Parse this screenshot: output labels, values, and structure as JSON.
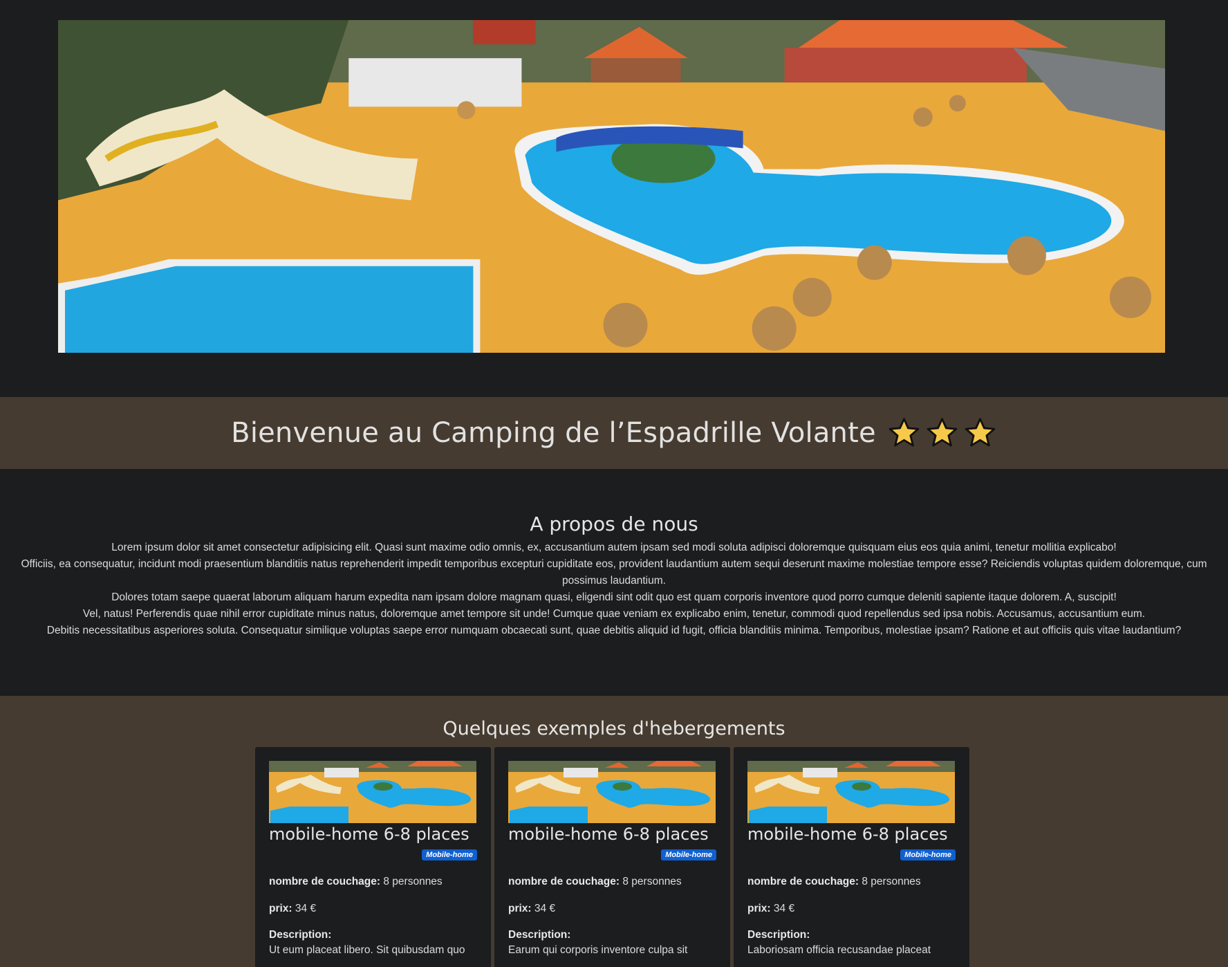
{
  "hero": {
    "alt": "Piscine et toboggans du camping"
  },
  "welcome": {
    "title": "Bienvenue au Camping de l’Espadrille Volante",
    "stars": 3,
    "star_color": "#f7c94a"
  },
  "about": {
    "title": "A propos de nous",
    "lines": [
      "Lorem ipsum dolor sit amet consectetur adipisicing elit. Quasi sunt maxime odio omnis, ex, accusantium autem ipsam sed modi soluta adipisci doloremque quisquam eius eos quia animi, tenetur mollitia explicabo!",
      "Officiis, ea consequatur, incidunt modi praesentium blanditiis natus reprehenderit impedit temporibus excepturi cupiditate eos, provident laudantium autem sequi deserunt maxime molestiae tempore esse? Reiciendis voluptas quidem doloremque, cum possimus laudantium.",
      "Dolores totam saepe quaerat laborum aliquam harum expedita nam ipsam dolore magnam quasi, eligendi sint odit quo est quam corporis inventore quod porro cumque deleniti sapiente itaque dolorem. A, suscipit!",
      "Vel, natus! Perferendis quae nihil error cupiditate minus natus, doloremque amet tempore sit unde! Cumque quae veniam ex explicabo enim, tenetur, commodi quod repellendus sed ipsa nobis. Accusamus, accusantium eum.",
      "Debitis necessitatibus asperiores soluta. Consequatur similique voluptas saepe error numquam obcaecati sunt, quae debitis aliquid id fugit, officia blanditiis minima. Temporibus, molestiae ipsam? Ratione et aut officiis quis vitae laudantium?"
    ]
  },
  "examples": {
    "title": "Quelques exemples d'hebergements",
    "cards": [
      {
        "title": "mobile-home 6-8 places",
        "badge": "Mobile-home",
        "beds_label": "nombre de couchage:",
        "beds_value": " 8 personnes",
        "price_label": "prix:",
        "price_value": " 34 €",
        "desc_label": "Description:",
        "desc_text": "Ut eum placeat libero. Sit quibusdam quo"
      },
      {
        "title": "mobile-home 6-8 places",
        "badge": "Mobile-home",
        "beds_label": "nombre de couchage:",
        "beds_value": " 8 personnes",
        "price_label": "prix:",
        "price_value": " 34 €",
        "desc_label": "Description:",
        "desc_text": "Earum qui corporis inventore culpa sit"
      },
      {
        "title": "mobile-home 6-8 places",
        "badge": "Mobile-home",
        "beds_label": "nombre de couchage:",
        "beds_value": " 8 personnes",
        "price_label": "prix:",
        "price_value": " 34 €",
        "desc_label": "Description:",
        "desc_text": "Laboriosam officia recusandae placeat"
      }
    ]
  },
  "colors": {
    "page_bg": "#1b1d1f",
    "band_bg": "#463b30",
    "badge_bg": "#1060d0"
  }
}
